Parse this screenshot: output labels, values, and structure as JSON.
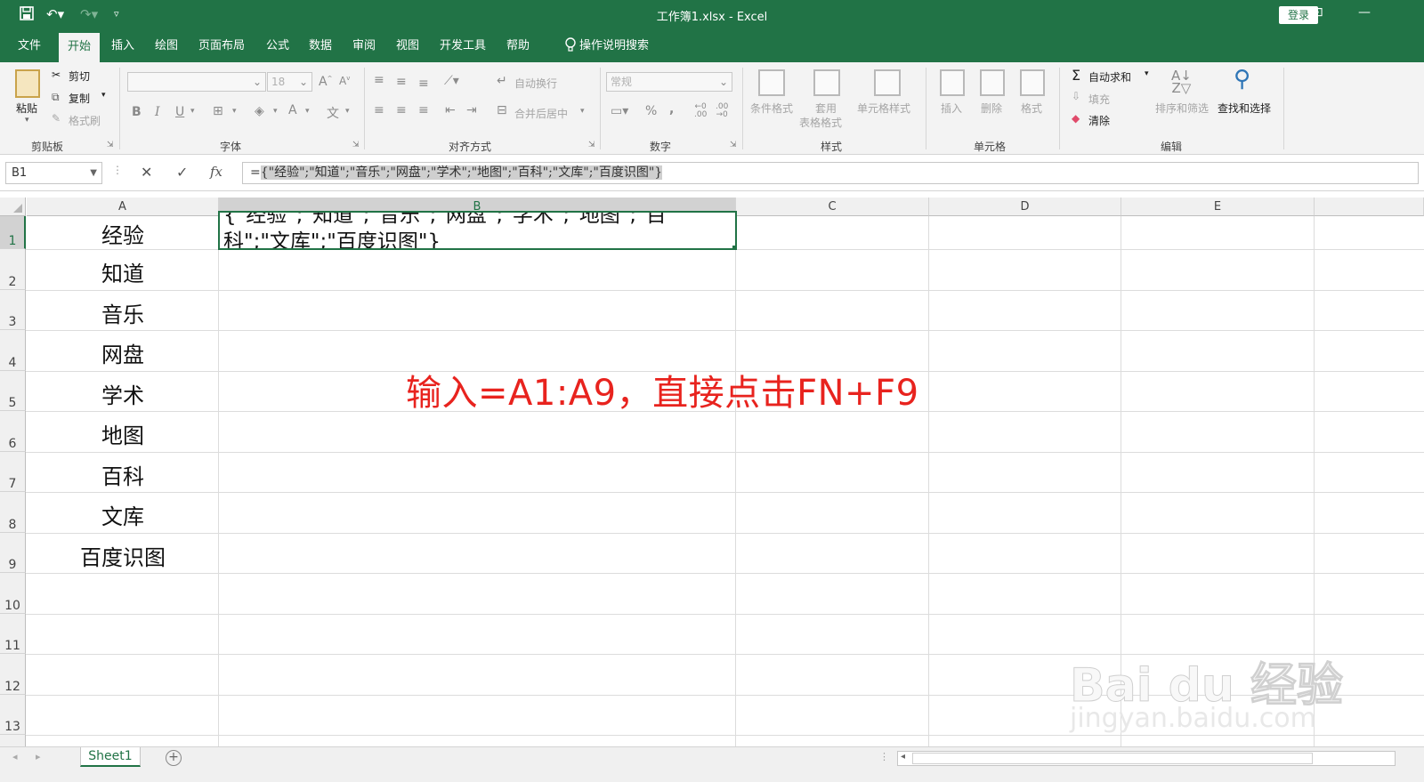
{
  "titlebar": {
    "title": "工作簿1.xlsx  -  Excel",
    "login": "登录",
    "save_icon": "save-icon",
    "undo_icon": "undo-icon",
    "redo_icon": "redo-icon"
  },
  "menu": {
    "tabs": [
      "文件",
      "开始",
      "插入",
      "绘图",
      "页面布局",
      "公式",
      "数据",
      "审阅",
      "视图",
      "开发工具",
      "帮助",
      "操作说明搜索"
    ],
    "active": "开始"
  },
  "ribbon": {
    "clipboard": {
      "paste": "粘贴",
      "cut": "剪切",
      "copy": "复制",
      "format_painter": "格式刷",
      "group": "剪贴板"
    },
    "font": {
      "font_name": "",
      "font_size": "18",
      "bold": "B",
      "italic": "I",
      "underline": "U",
      "group": "字体"
    },
    "alignment": {
      "wrap": "自动换行",
      "merge": "合并后居中",
      "group": "对齐方式"
    },
    "number": {
      "format": "常规",
      "percent": "%",
      "comma": ",",
      "group": "数字"
    },
    "styles": {
      "conditional": "条件格式",
      "table_line1": "套用",
      "table_line2": "表格格式",
      "cell_styles": "单元格样式",
      "group": "样式"
    },
    "cells": {
      "insert": "插入",
      "delete": "删除",
      "format": "格式",
      "group": "单元格"
    },
    "editing": {
      "autosum": "自动求和",
      "fill": "填充",
      "clear": "清除",
      "sort": "排序和筛选",
      "find": "查找和选择",
      "group": "编辑"
    }
  },
  "formula_bar": {
    "name_box": "B1",
    "prefix": "=",
    "formula": "{\"经验\";\"知道\";\"音乐\";\"网盘\";\"学术\";\"地图\";\"百科\";\"文库\";\"百度识图\"}"
  },
  "sheet": {
    "columns": [
      "A",
      "B",
      "C",
      "D",
      "E"
    ],
    "rows": [
      "1",
      "2",
      "3",
      "4",
      "5",
      "6",
      "7",
      "8",
      "9",
      "10",
      "11",
      "12",
      "13"
    ],
    "column_a": [
      "经验",
      "知道",
      "音乐",
      "网盘",
      "学术",
      "地图",
      "百科",
      "文库",
      "百度识图"
    ],
    "b1_line1": "{\"经验\";\"知道\";\"音乐\";\"网盘\";\"学术\";\"地图\";\"百",
    "b1_line2": "科\";\"文库\";\"百度识图\"}"
  },
  "annotation": "输入=A1:A9，直接点击FN+F9",
  "watermark": {
    "brand": "Bai du 经验",
    "url": "jingyan.baidu.com"
  },
  "statusbar": {
    "sheet_tab": "Sheet1",
    "add_sheet": "+"
  },
  "colors": {
    "excel_green": "#217346",
    "annotation_red": "#e8231e"
  }
}
